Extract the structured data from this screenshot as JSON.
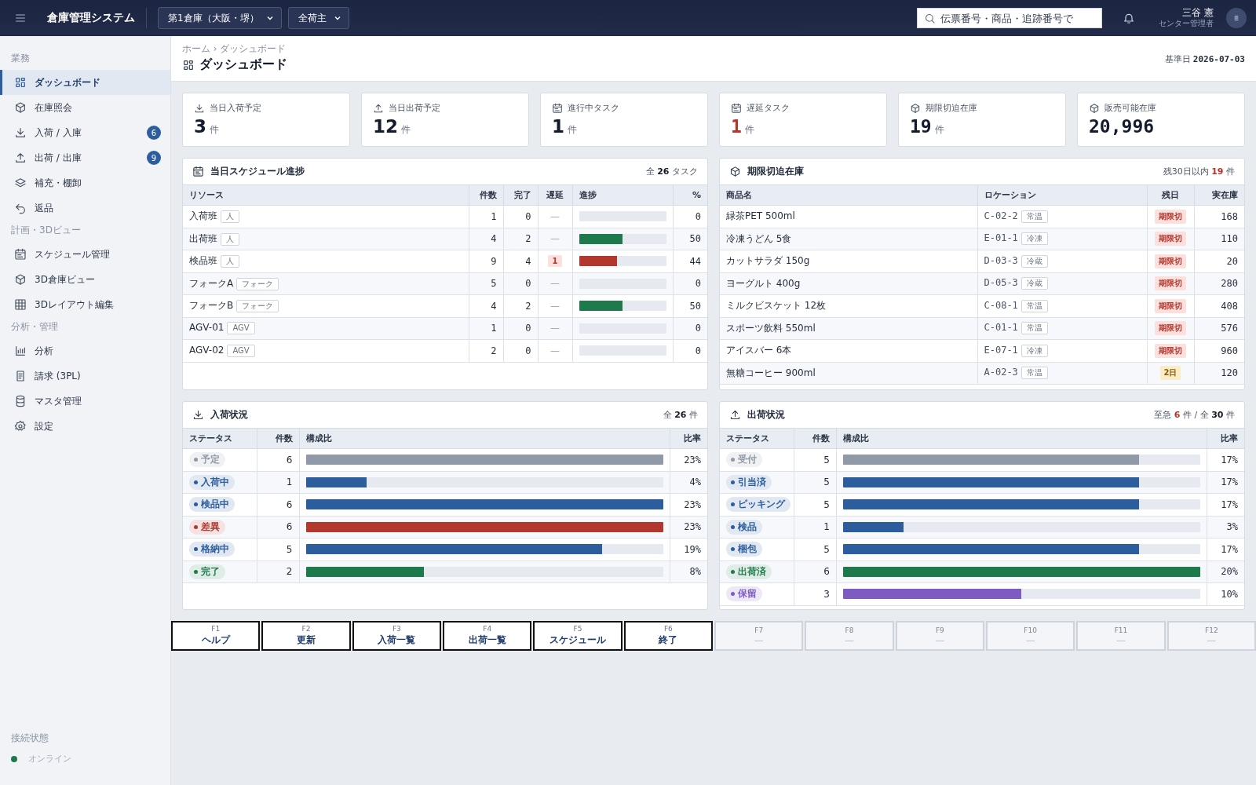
{
  "header": {
    "app_title": "倉庫管理システム",
    "selects": [
      {
        "value": "第1倉庫（大阪・堺）"
      },
      {
        "value": "全荷主"
      }
    ],
    "search": {
      "placeholder": "伝票番号・商品・追跡番号で"
    },
    "user": {
      "name": "三谷 憲",
      "role": "センター管理者"
    }
  },
  "sidebar": {
    "sections": [
      {
        "heading": "業務",
        "items": [
          {
            "label": "ダッシュボード",
            "selected": true
          },
          {
            "label": "在庫照会",
            "selected": false
          },
          {
            "label": "入荷 / 入庫",
            "badge": "6",
            "selected": false
          },
          {
            "label": "出荷 / 出庫",
            "badge": "9",
            "selected": false
          },
          {
            "label": "補充・棚卸",
            "selected": false
          },
          {
            "label": "返品",
            "selected": false
          }
        ]
      },
      {
        "heading": "計画・3Dビュー",
        "items": [
          {
            "label": "スケジュール管理",
            "selected": false
          },
          {
            "label": "3D倉庫ビュー",
            "selected": false
          },
          {
            "label": "3Dレイアウト編集",
            "selected": false
          }
        ]
      },
      {
        "heading": "分析・管理",
        "items": [
          {
            "label": "分析",
            "selected": false
          },
          {
            "label": "請求 (3PL)",
            "selected": false
          },
          {
            "label": "マスタ管理",
            "selected": false
          },
          {
            "label": "設定",
            "selected": false
          }
        ]
      }
    ],
    "connection": {
      "heading": "接続状態",
      "status": "オンライン",
      "online": true
    }
  },
  "page": {
    "breadcrumb": "ホーム › ダッシュボード",
    "title": "ダッシュボード",
    "date_label": "基準日",
    "date": "2026-07-03"
  },
  "kpis": [
    {
      "label": "当日入荷予定",
      "value": "3",
      "unit": "件",
      "alert": false
    },
    {
      "label": "当日出荷予定",
      "value": "12",
      "unit": "件",
      "alert": false
    },
    {
      "label": "進行中タスク",
      "value": "1",
      "unit": "件",
      "alert": false
    },
    {
      "label": "遅延タスク",
      "value": "1",
      "unit": "件",
      "alert": true
    },
    {
      "label": "期限切迫在庫",
      "value": "19",
      "unit": "件",
      "alert": false
    },
    {
      "label": "販売可能在庫",
      "value": "20,996",
      "alert": false
    }
  ],
  "schedule": {
    "title": "当日スケジュール進捗",
    "summary": [
      {
        "text": "全 "
      },
      {
        "text": "**26**",
        "alert": false
      },
      {
        "text": " タスク"
      }
    ],
    "columns": [
      "リソース",
      "件数",
      "完了",
      "遅延",
      "進捗",
      "%"
    ],
    "rows": [
      {
        "resource": "入荷班",
        "tag": "人",
        "count": "1",
        "done": "0",
        "delay": "—",
        "late": false,
        "level": 0,
        "pct": "0"
      },
      {
        "resource": "出荷班",
        "tag": "人",
        "count": "4",
        "done": "2",
        "delay": "—",
        "late": false,
        "level": 0.5,
        "pct": "50"
      },
      {
        "resource": "検品班",
        "tag": "人",
        "count": "9",
        "done": "4",
        "delay": "1",
        "late": true,
        "level": 0.44,
        "pct": "44"
      },
      {
        "resource": "フォークA",
        "tag": "フォーク",
        "count": "5",
        "done": "0",
        "delay": "—",
        "late": false,
        "level": 0,
        "pct": "0"
      },
      {
        "resource": "フォークB",
        "tag": "フォーク",
        "count": "4",
        "done": "2",
        "delay": "—",
        "late": false,
        "level": 0.5,
        "pct": "50"
      },
      {
        "resource": "AGV-01",
        "tag": "AGV",
        "count": "1",
        "done": "0",
        "delay": "—",
        "late": false,
        "level": 0,
        "pct": "0"
      },
      {
        "resource": "AGV-02",
        "tag": "AGV",
        "count": "2",
        "done": "0",
        "delay": "—",
        "late": false,
        "level": 0,
        "pct": "0"
      }
    ]
  },
  "expiry": {
    "title": "期限切迫在庫",
    "summary": [
      {
        "text": "残30日以内 "
      },
      {
        "text": "**19**",
        "alert": true
      },
      {
        "text": " 件"
      }
    ],
    "columns": [
      "商品名",
      "ロケーション",
      "残日",
      "実在庫"
    ],
    "rows": [
      {
        "name": "緑茶PET 500ml",
        "location": "C-02-2",
        "zone": "常温",
        "remaining": "期限切",
        "expired": true,
        "stock": "168"
      },
      {
        "name": "冷凍うどん 5食",
        "location": "E-01-1",
        "zone": "冷凍",
        "remaining": "期限切",
        "expired": true,
        "stock": "110"
      },
      {
        "name": "カットサラダ 150g",
        "location": "D-03-3",
        "zone": "冷蔵",
        "remaining": "期限切",
        "expired": true,
        "stock": "20"
      },
      {
        "name": "ヨーグルト 400g",
        "location": "D-05-3",
        "zone": "冷蔵",
        "remaining": "期限切",
        "expired": true,
        "stock": "280"
      },
      {
        "name": "ミルクビスケット 12枚",
        "location": "C-08-1",
        "zone": "常温",
        "remaining": "期限切",
        "expired": true,
        "stock": "408"
      },
      {
        "name": "スポーツ飲料 550ml",
        "location": "C-01-1",
        "zone": "常温",
        "remaining": "期限切",
        "expired": true,
        "stock": "576"
      },
      {
        "name": "アイスバー 6本",
        "location": "E-07-1",
        "zone": "冷凍",
        "remaining": "期限切",
        "expired": true,
        "stock": "960"
      },
      {
        "name": "無糖コーヒー 900ml",
        "location": "A-02-3",
        "zone": "常温",
        "remaining": "2日",
        "expired": false,
        "stock": "120"
      }
    ]
  },
  "inbound": {
    "title": "入荷状況",
    "summary": [
      {
        "text": "全 "
      },
      {
        "text": "**26**",
        "alert": false
      },
      {
        "text": " 件"
      }
    ],
    "columns": [
      "ステータス",
      "件数",
      "構成比",
      "比率"
    ],
    "rows": [
      {
        "status": "予定",
        "color": "#8f99a8",
        "count": "6",
        "level": 1,
        "pct": "23%"
      },
      {
        "status": "入荷中",
        "color": "#2c5d9c",
        "count": "1",
        "level": 0.17,
        "pct": "4%"
      },
      {
        "status": "検品中",
        "color": "#2c5d9c",
        "count": "6",
        "level": 1,
        "pct": "23%"
      },
      {
        "status": "差異",
        "color": "#b3372d",
        "count": "6",
        "level": 1,
        "pct": "23%"
      },
      {
        "status": "格納中",
        "color": "#2c5d9c",
        "count": "5",
        "level": 0.83,
        "pct": "19%"
      },
      {
        "status": "完了",
        "color": "#1e7a4c",
        "count": "2",
        "level": 0.33,
        "pct": "8%"
      }
    ]
  },
  "outbound": {
    "title": "出荷状況",
    "summary": [
      {
        "text": "至急 "
      },
      {
        "text": "**6**",
        "alert": true
      },
      {
        "text": " 件 / 全 "
      },
      {
        "text": "**30**",
        "alert": false
      },
      {
        "text": " 件"
      }
    ],
    "columns": [
      "ステータス",
      "件数",
      "構成比",
      "比率"
    ],
    "rows": [
      {
        "status": "受付",
        "color": "#8f99a8",
        "count": "5",
        "level": 0.83,
        "pct": "17%"
      },
      {
        "status": "引当済",
        "color": "#2c5d9c",
        "count": "5",
        "level": 0.83,
        "pct": "17%"
      },
      {
        "status": "ピッキング",
        "color": "#2c5d9c",
        "count": "5",
        "level": 0.83,
        "pct": "17%"
      },
      {
        "status": "検品",
        "color": "#2c5d9c",
        "count": "1",
        "level": 0.17,
        "pct": "3%"
      },
      {
        "status": "梱包",
        "color": "#2c5d9c",
        "count": "5",
        "level": 0.83,
        "pct": "17%"
      },
      {
        "status": "出荷済",
        "color": "#1e7a4c",
        "count": "6",
        "level": 1,
        "pct": "20%"
      },
      {
        "status": "保留",
        "color": "#7e5bc2",
        "count": "3",
        "level": 0.5,
        "pct": "10%"
      }
    ]
  },
  "function_keys": [
    {
      "key": "F1",
      "label": "ヘルプ",
      "disabled": false
    },
    {
      "key": "F2",
      "label": "更新",
      "disabled": false
    },
    {
      "key": "F3",
      "label": "入荷一覧",
      "disabled": false
    },
    {
      "key": "F4",
      "label": "出荷一覧",
      "disabled": false
    },
    {
      "key": "F5",
      "label": "スケジュール",
      "disabled": false
    },
    {
      "key": "F6",
      "label": "終了",
      "disabled": false
    },
    {
      "key": "F7",
      "label": "—",
      "disabled": true
    },
    {
      "key": "F8",
      "label": "—",
      "disabled": true
    },
    {
      "key": "F9",
      "label": "—",
      "disabled": true
    },
    {
      "key": "F10",
      "label": "—",
      "disabled": true
    },
    {
      "key": "F11",
      "label": "—",
      "disabled": true
    },
    {
      "key": "F12",
      "label": "—",
      "disabled": true
    }
  ]
}
